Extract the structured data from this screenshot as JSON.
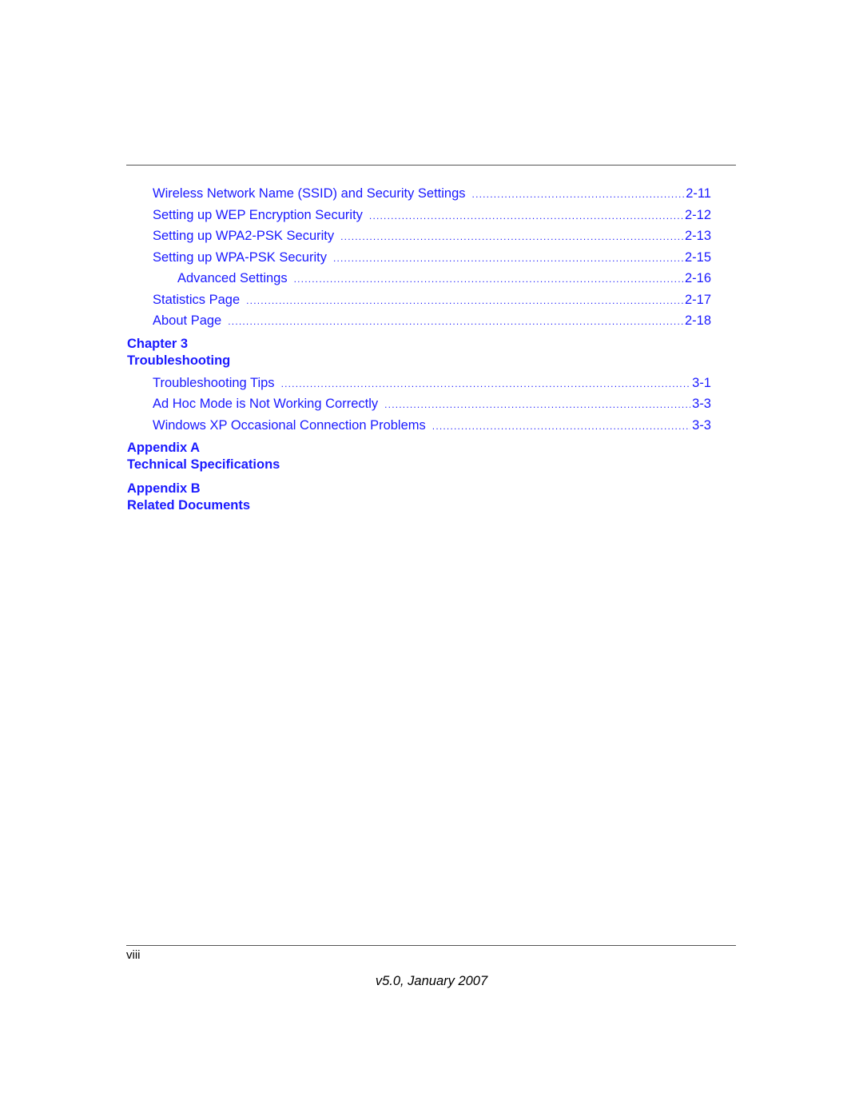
{
  "toc": {
    "chapter2_entries": [
      {
        "title": "Wireless Network Name (SSID) and Security Settings",
        "page": "2-11"
      },
      {
        "title": "Setting up WEP Encryption Security",
        "page": "2-12"
      },
      {
        "title": "Setting up WPA2-PSK Security",
        "page": "2-13"
      },
      {
        "title": "Setting up WPA-PSK Security",
        "page": "2-15"
      },
      {
        "title": "Advanced Settings",
        "page": "2-16"
      },
      {
        "title": "Statistics Page",
        "page": "2-17"
      },
      {
        "title": "About Page",
        "page": "2-18"
      }
    ],
    "chapter3": {
      "label": "Chapter 3",
      "title": "Troubleshooting",
      "entries": [
        {
          "title": "Troubleshooting Tips",
          "page": "3-1"
        },
        {
          "title": "Ad Hoc Mode is Not Working Correctly",
          "page": "3-3"
        },
        {
          "title": "Windows XP Occasional Connection Problems",
          "page": "3-3"
        }
      ]
    },
    "appendix_a": {
      "label": "Appendix A",
      "title": "Technical Specifications"
    },
    "appendix_b": {
      "label": "Appendix B",
      "title": "Related Documents"
    }
  },
  "footer": {
    "page_number": "viii",
    "version": "v5.0, January 2007"
  }
}
